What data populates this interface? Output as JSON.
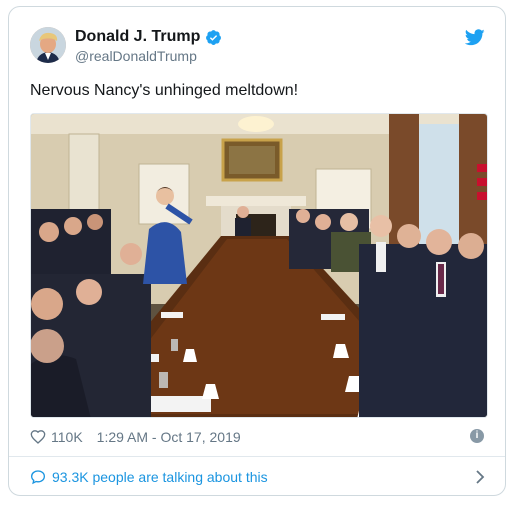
{
  "tweet": {
    "display_name": "Donald J. Trump",
    "handle": "@realDonaldTrump",
    "text": "Nervous Nancy's unhinged meltdown!",
    "likes": "110K",
    "timestamp": "1:29 AM - Oct 17, 2019",
    "talking": "93.3K people are talking about this"
  },
  "icons": {
    "verified": "verified-badge-icon",
    "brand": "twitter-bird-icon",
    "like": "heart-icon",
    "info": "info-icon",
    "reply": "speech-bubble-icon",
    "more": "chevron-right-icon"
  },
  "colors": {
    "accent": "#1da1f2",
    "link": "#1b95e0",
    "muted": "#657786",
    "border": "#cfd9de"
  }
}
